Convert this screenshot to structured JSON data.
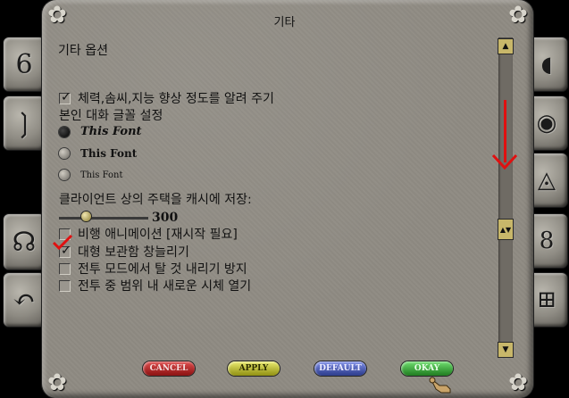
{
  "window": {
    "title": "기타"
  },
  "section": {
    "heading": "기타 옵션"
  },
  "options": [
    {
      "label": "체력,솜씨,지능 향상 정도를 알려 주기",
      "checked": true
    }
  ],
  "font_setting": {
    "label": "본인 대화 글꼴 설정",
    "choices": [
      "This Font",
      "This Font",
      "This Font"
    ],
    "selected_index": 0
  },
  "cache": {
    "label": "클라이언트 상의 주택을 캐시에 저장:",
    "value": "300",
    "slider_level": 0.28
  },
  "checkboxes": [
    {
      "label": "비행 애니메이션 [재시작 필요]",
      "checked": false
    },
    {
      "label": "대형 보관함 창늘리기",
      "checked": true
    },
    {
      "label": "전투 모드에서 탈 것 내리기 방지",
      "checked": false
    },
    {
      "label": "전투 중 범위 내 새로운 시체 열기",
      "checked": false
    }
  ],
  "buttons": {
    "cancel": "CANCEL",
    "apply": "APPLY",
    "default": "DEFAULT",
    "okay": "OKAY"
  },
  "scrollbar": {
    "up_icon": "up-arrow-icon",
    "down_icon": "down-arrow-icon",
    "thumb_icon": "grip-icon"
  },
  "colors": {
    "stone": "#8f8b83",
    "annotation_red": "#e01010",
    "scroll_gold": "#c8b76a"
  }
}
